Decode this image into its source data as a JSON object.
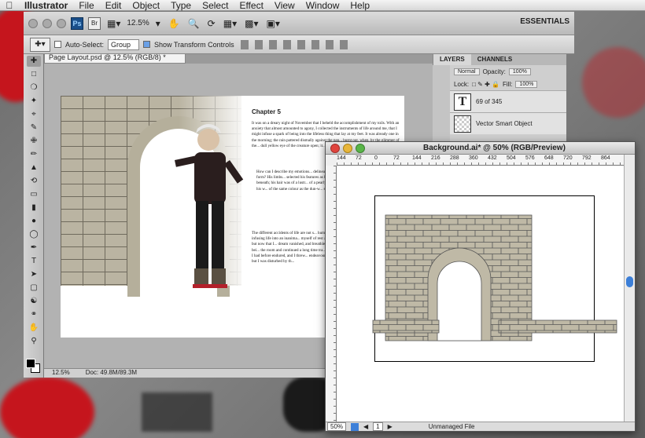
{
  "menubar": {
    "app": "Illustrator",
    "items": [
      "File",
      "Edit",
      "Object",
      "Type",
      "Select",
      "Effect",
      "View",
      "Window",
      "Help"
    ]
  },
  "appbar": {
    "ps_label": "Ps",
    "br_label": "Br",
    "zoom": "12.5%",
    "workspace": "ESSENTIALS"
  },
  "options": {
    "auto_select_label": "Auto-Select:",
    "group_value": "Group",
    "show_transform_label": "Show Transform Controls",
    "show_transform_checked": true
  },
  "ps_doc": {
    "tab_title": "Page Layout.psd @ 12.5% (RGB/8) *",
    "zoom": "12.5%",
    "doc_info": "Doc: 49.8M/89.3M"
  },
  "page_text": {
    "chapter": "Chapter 5",
    "p1": "It was on a dreary night of November that I beheld the accomplishment of my toils. With an anxiety that almost amounted to agony, I collected the instruments of life around me, that I might infuse a spark of being into the lifeless thing that lay at my feet. It was already one in the morning; the rain pattered dismally against the pan... burnt out, when, by the glimmer of the... dull yellow eye of the creature open; it... motion agitated its limbs.",
    "p2": "How can I describe my emotions... delineate the wretch whom with su... endeavoured to form? His limbs... selected his features as beaut... yellow skin scarcely covered th... beneath; his hair was of a lustr... of a pearly whiteness; but th... more horrid contrast with his w... of the same colour as the dun-w... set, his shrivelled complexion and st...",
    "p3": "The different accidents of life are not s... human nature. I had worked hard for... purpose of infusing life into an inanima... myself of rest and health. I had des... exceeded moderation; but now that I... dream vanished, and breathless horr... Unable to endure the aspect of the bei... the room and continued a long time tra... to compose my mind to sleep. At len... tumult I had before endured, and I threw... endeavouring to seek a few moments o... I slept, indeed, but I was disturbed by th..."
  },
  "layers": {
    "tab_layers": "LAYERS",
    "tab_channels": "CHANNELS",
    "blend": "Normal",
    "opacity_label": "Opacity:",
    "opacity": "100%",
    "lock_label": "Lock:",
    "fill_label": "Fill:",
    "fill": "100%",
    "items": [
      {
        "thumb": "T",
        "name": "69 of 345"
      },
      {
        "thumb": "",
        "name": "Vector Smart Object"
      }
    ]
  },
  "ai_doc": {
    "title": "Background.ai* @ 50% (RGB/Preview)",
    "zoom": "50%",
    "page": "1",
    "status": "Unmanaged File",
    "ruler": [
      "144",
      "72",
      "0",
      "72",
      "144",
      "216",
      "288",
      "360",
      "432",
      "504",
      "576",
      "648",
      "720",
      "792",
      "864"
    ]
  }
}
